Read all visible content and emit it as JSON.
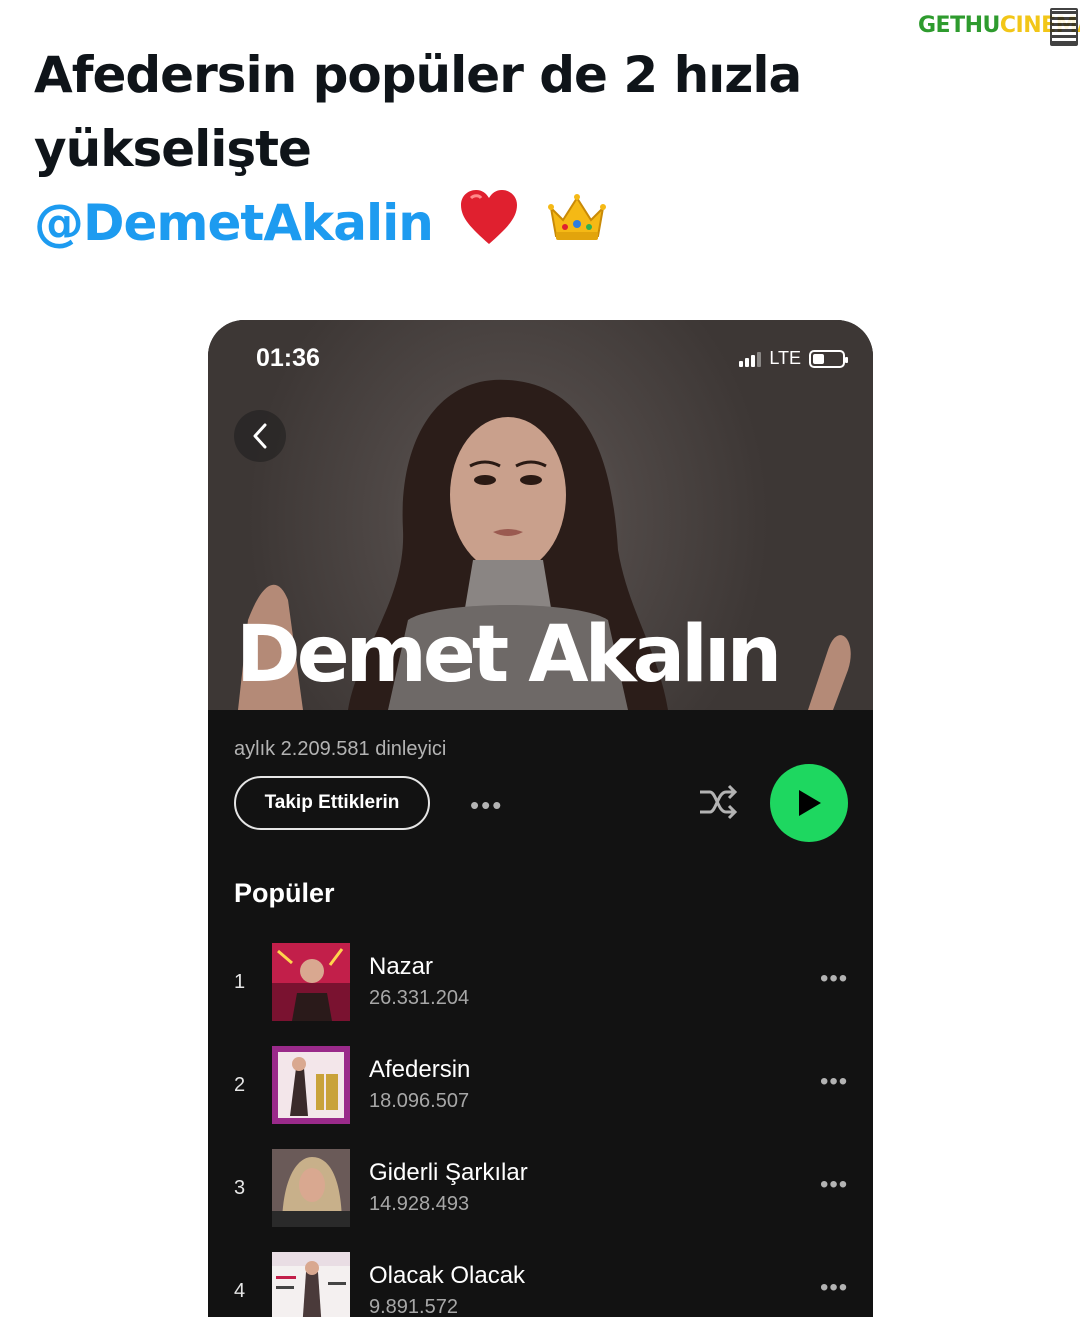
{
  "watermark": {
    "part1": "GETHU",
    "part2": "CINEMA"
  },
  "tweet": {
    "line1": "Afedersin popüler de 2 hızla",
    "line2": "yükselişte",
    "mention": "@DemetAkalin",
    "emojis": [
      "red-heart-icon",
      "crown-icon"
    ]
  },
  "phone": {
    "status": {
      "time": "01:36",
      "network": "LTE"
    },
    "artist": {
      "name": "Demet Akalın",
      "monthly_listeners": "aylık 2.209.581 dinleyici",
      "follow_label": "Takip Ettiklerin",
      "more_label": "•••"
    },
    "popular": {
      "title": "Popüler",
      "tracks": [
        {
          "number": "1",
          "title": "Nazar",
          "plays": "26.331.204",
          "more": "•••"
        },
        {
          "number": "2",
          "title": "Afedersin",
          "plays": "18.096.507",
          "more": "•••"
        },
        {
          "number": "3",
          "title": "Giderli Şarkılar",
          "plays": "14.928.493",
          "more": "•••"
        },
        {
          "number": "4",
          "title": "Olacak Olacak",
          "plays": "9.891.572",
          "more": "•••"
        }
      ]
    },
    "colors": {
      "accent": "#1ed760",
      "background": "#121212",
      "mention": "#1d9bf0"
    }
  }
}
